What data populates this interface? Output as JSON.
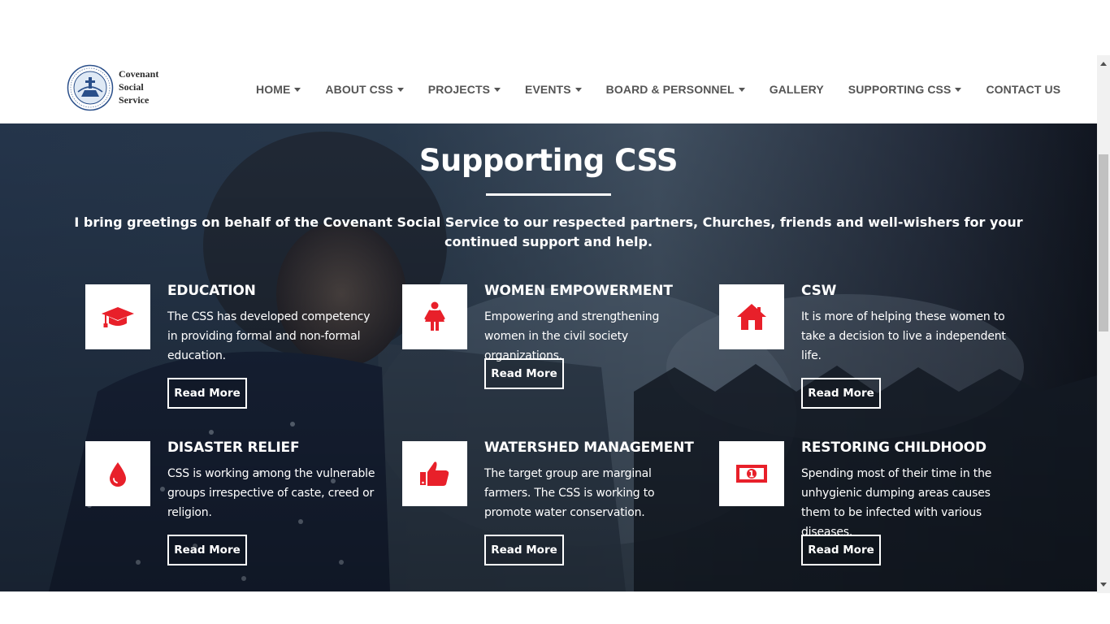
{
  "logo": {
    "line1": "Covenant",
    "line2": "Social",
    "line3": "Service",
    "seal_text": "Covenant Social Service"
  },
  "nav": [
    {
      "label": "HOME",
      "dropdown": true
    },
    {
      "label": "ABOUT CSS",
      "dropdown": true
    },
    {
      "label": "PROJECTS",
      "dropdown": true
    },
    {
      "label": "EVENTS",
      "dropdown": true
    },
    {
      "label": "BOARD & PERSONNEL",
      "dropdown": true
    },
    {
      "label": "GALLERY",
      "dropdown": false
    },
    {
      "label": "SUPPORTING CSS",
      "dropdown": true
    },
    {
      "label": "CONTACT US",
      "dropdown": false
    }
  ],
  "hero": {
    "title": "Supporting CSS",
    "intro": "I bring greetings on behalf of the Covenant Social Service to our respected partners, Churches, friends and well-wishers for your continued support and help."
  },
  "features": [
    {
      "title": "EDUCATION",
      "desc": "The CSS has developed competency in providing formal and non-formal education.",
      "button": "Read More",
      "icon": "graduation-cap-icon"
    },
    {
      "title": "WOMEN EMPOWERMENT",
      "desc": "Empowering and strengthening women in the civil society organizations.",
      "button": "Read More",
      "icon": "female-icon"
    },
    {
      "title": "CSW",
      "desc": "It is more of helping these women to take a decision to live a independent life.",
      "button": "Read More",
      "icon": "home-icon"
    },
    {
      "title": "DISASTER RELIEF",
      "desc": "CSS is working among the vulnerable groups irrespective of caste, creed or religion.",
      "button": "Read More",
      "icon": "blood-drop-icon"
    },
    {
      "title": "WATERSHED MANAGEMENT",
      "desc": "The target group are marginal farmers. The CSS is working to promote water conservation.",
      "button": "Read More",
      "icon": "thumbs-up-icon"
    },
    {
      "title": "RESTORING CHILDHOOD",
      "desc": "Spending most of their time in the unhygienic dumping areas causes them to be infected with various diseases.",
      "button": "Read More",
      "icon": "money-icon"
    }
  ],
  "colors": {
    "accent": "#e8202a",
    "nav_text": "#555555",
    "overlay": "#233247"
  }
}
